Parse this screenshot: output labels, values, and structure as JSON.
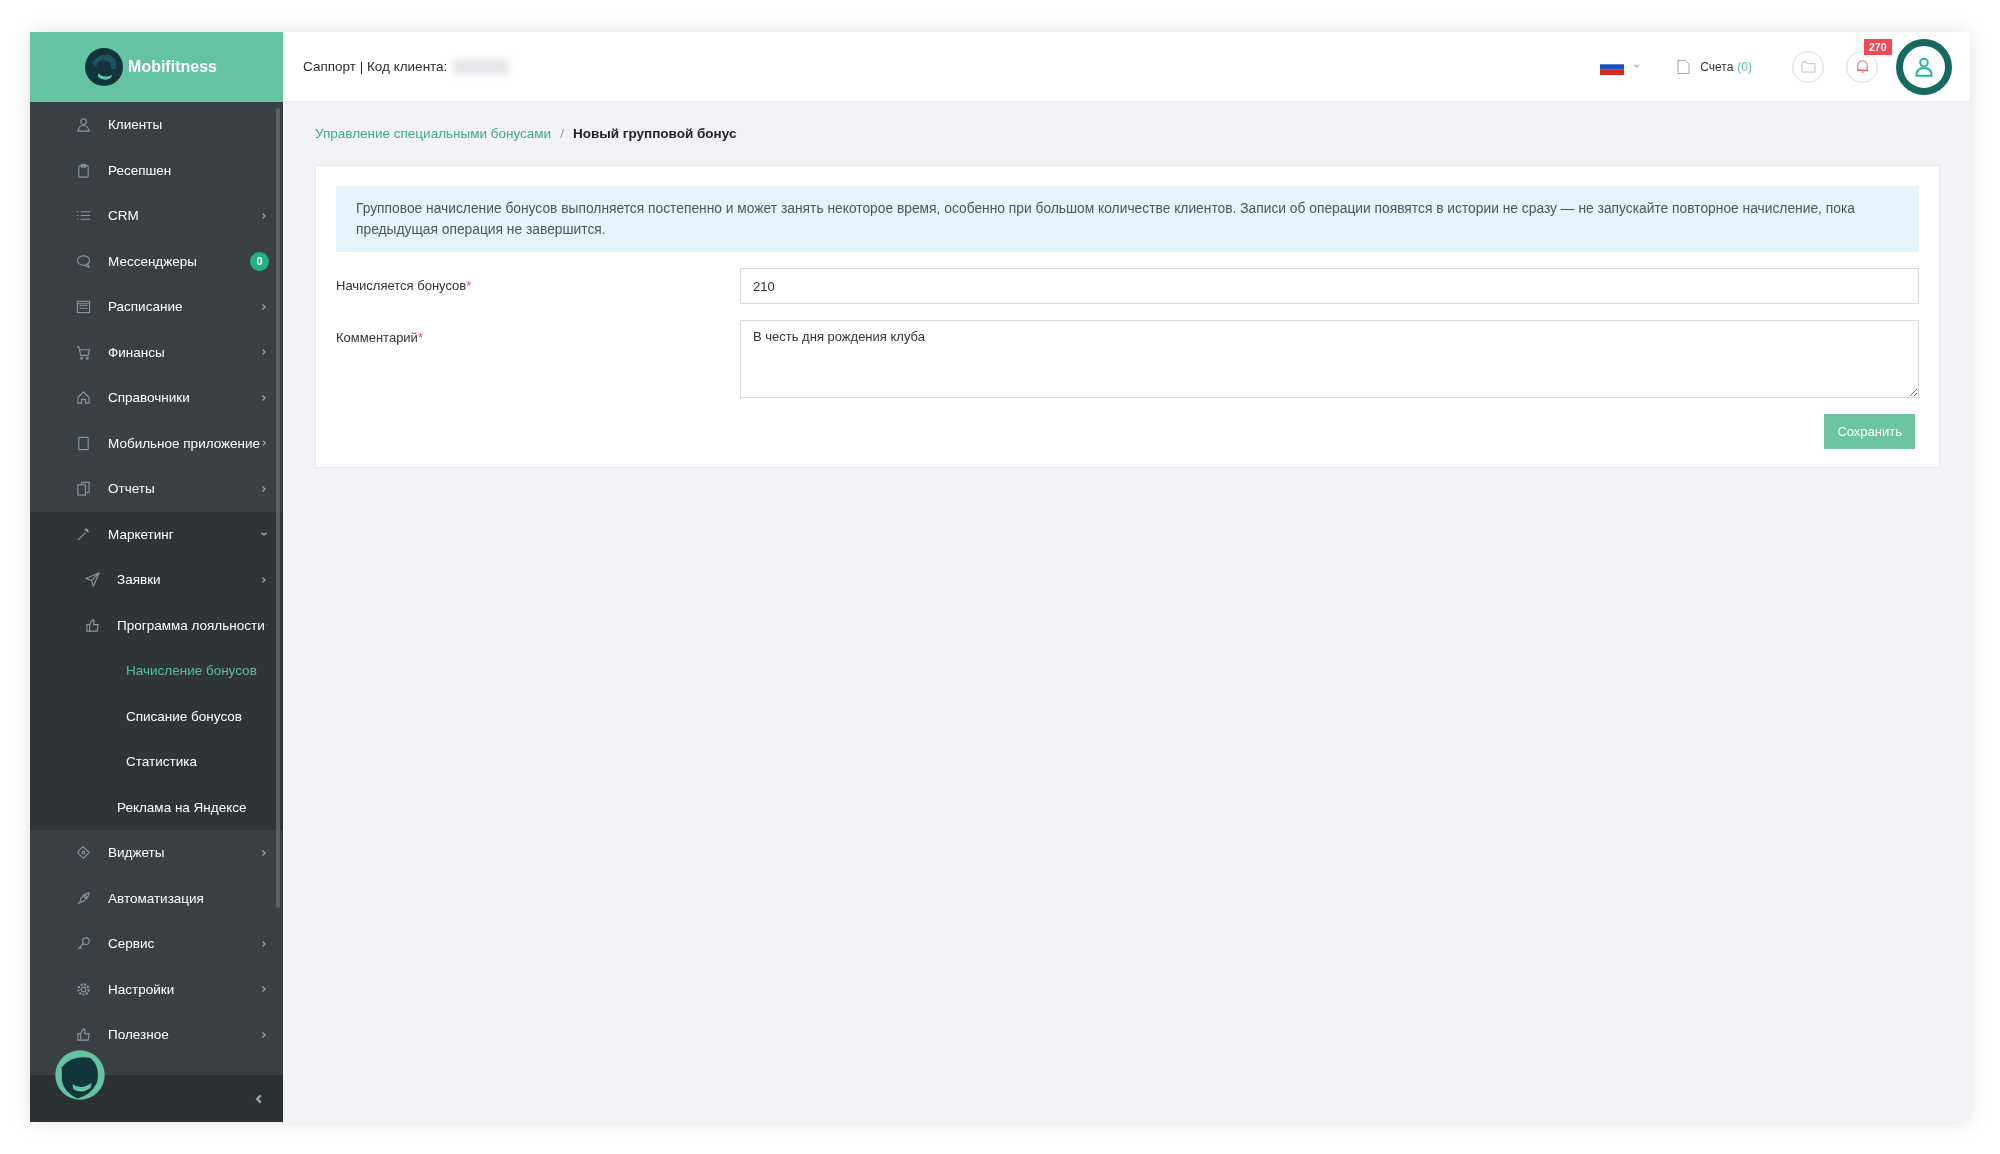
{
  "brand": {
    "name": "Mobifitness"
  },
  "header": {
    "support_label": "Саппорт | Код клиента:",
    "invoices_label": "Счета",
    "invoices_count": "(0)",
    "notifications_badge": "270"
  },
  "sidebar": {
    "items": [
      {
        "label": "Клиенты",
        "expandable": false,
        "expanded": false,
        "selected": false
      },
      {
        "label": "Ресепшен",
        "expandable": false,
        "expanded": false,
        "selected": false
      },
      {
        "label": "CRM",
        "expandable": true,
        "expanded": false,
        "selected": false
      },
      {
        "label": "Мессенджеры",
        "expandable": false,
        "expanded": false,
        "selected": false,
        "badge": "0"
      },
      {
        "label": "Расписание",
        "expandable": true,
        "expanded": false,
        "selected": false
      },
      {
        "label": "Финансы",
        "expandable": true,
        "expanded": false,
        "selected": false
      },
      {
        "label": "Справочники",
        "expandable": true,
        "expanded": false,
        "selected": false
      },
      {
        "label": "Мобильное приложение",
        "expandable": true,
        "expanded": false,
        "selected": false
      },
      {
        "label": "Отчеты",
        "expandable": true,
        "expanded": false,
        "selected": false
      },
      {
        "label": "Маркетинг",
        "expandable": true,
        "expanded": true,
        "selected": false,
        "children": [
          {
            "label": "Заявки",
            "expandable": true,
            "expanded": false,
            "selected": false
          },
          {
            "label": "Программа лояльности",
            "expandable": true,
            "expanded": true,
            "selected": false,
            "children": [
              {
                "label": "Начисление бонусов",
                "expandable": false,
                "expanded": false,
                "selected": true
              },
              {
                "label": "Списание бонусов",
                "expandable": false,
                "expanded": false,
                "selected": false
              },
              {
                "label": "Статистика",
                "expandable": false,
                "expanded": false,
                "selected": false
              }
            ]
          },
          {
            "label": "Реклама на Яндексе",
            "expandable": false,
            "expanded": false,
            "selected": false
          }
        ]
      },
      {
        "label": "Виджеты",
        "expandable": true,
        "expanded": false,
        "selected": false
      },
      {
        "label": "Автоматизация",
        "expandable": false,
        "expanded": false,
        "selected": false
      },
      {
        "label": "Сервис",
        "expandable": true,
        "expanded": false,
        "selected": false
      },
      {
        "label": "Настройки",
        "expandable": true,
        "expanded": false,
        "selected": false
      },
      {
        "label": "Полезное",
        "expandable": true,
        "expanded": false,
        "selected": false
      }
    ]
  },
  "breadcrumb": [
    {
      "label": "Управление специальными бонусами",
      "kind": "link"
    },
    {
      "label": "/",
      "kind": "separator"
    },
    {
      "label": "Новый групповой бонус",
      "kind": "current"
    }
  ],
  "notice": "Групповое начисление бонусов выполняется постепенно и может занять некоторое время, особенно при большом количестве клиентов. Записи об операции появятся в истории не сразу — не запускайте повторное начисление, пока предыдущая операция не завершится.",
  "form": {
    "fields": [
      {
        "label": "Начисляется бонусов",
        "required": true,
        "kind": "input",
        "value": "210"
      },
      {
        "label": "Комментарий",
        "required": true,
        "kind": "textarea",
        "value": "В честь дня рождения клуба"
      }
    ],
    "required_mark": "*",
    "submit": "Сохранить"
  }
}
